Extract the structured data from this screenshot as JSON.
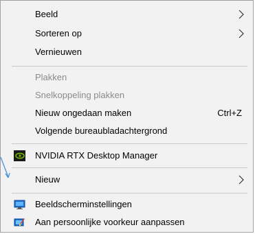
{
  "menu": {
    "items": [
      {
        "label": "Beeld",
        "submenu": true
      },
      {
        "label": "Sorteren op",
        "submenu": true
      },
      {
        "label": "Vernieuwen"
      },
      {
        "label": "Plakken",
        "disabled": true
      },
      {
        "label": "Snelkoppeling plakken",
        "disabled": true
      },
      {
        "label": "Nieuw ongedaan maken",
        "shortcut": "Ctrl+Z"
      },
      {
        "label": "Volgende bureaubladachtergrond"
      },
      {
        "label": "NVIDIA RTX Desktop Manager",
        "icon": "nvidia-icon"
      },
      {
        "label": "Nieuw",
        "submenu": true
      },
      {
        "label": "Beeldscherminstellingen",
        "icon": "display-settings-icon"
      },
      {
        "label": "Aan persoonlijke voorkeur aanpassen",
        "icon": "personalize-icon"
      }
    ]
  },
  "colors": {
    "menu_bg": "#f2f2f2",
    "disabled_text": "#8a8a8a",
    "separator": "#c8c8c8",
    "nvidia_green": "#76b900",
    "arrow_blue": "#4a90d9"
  }
}
